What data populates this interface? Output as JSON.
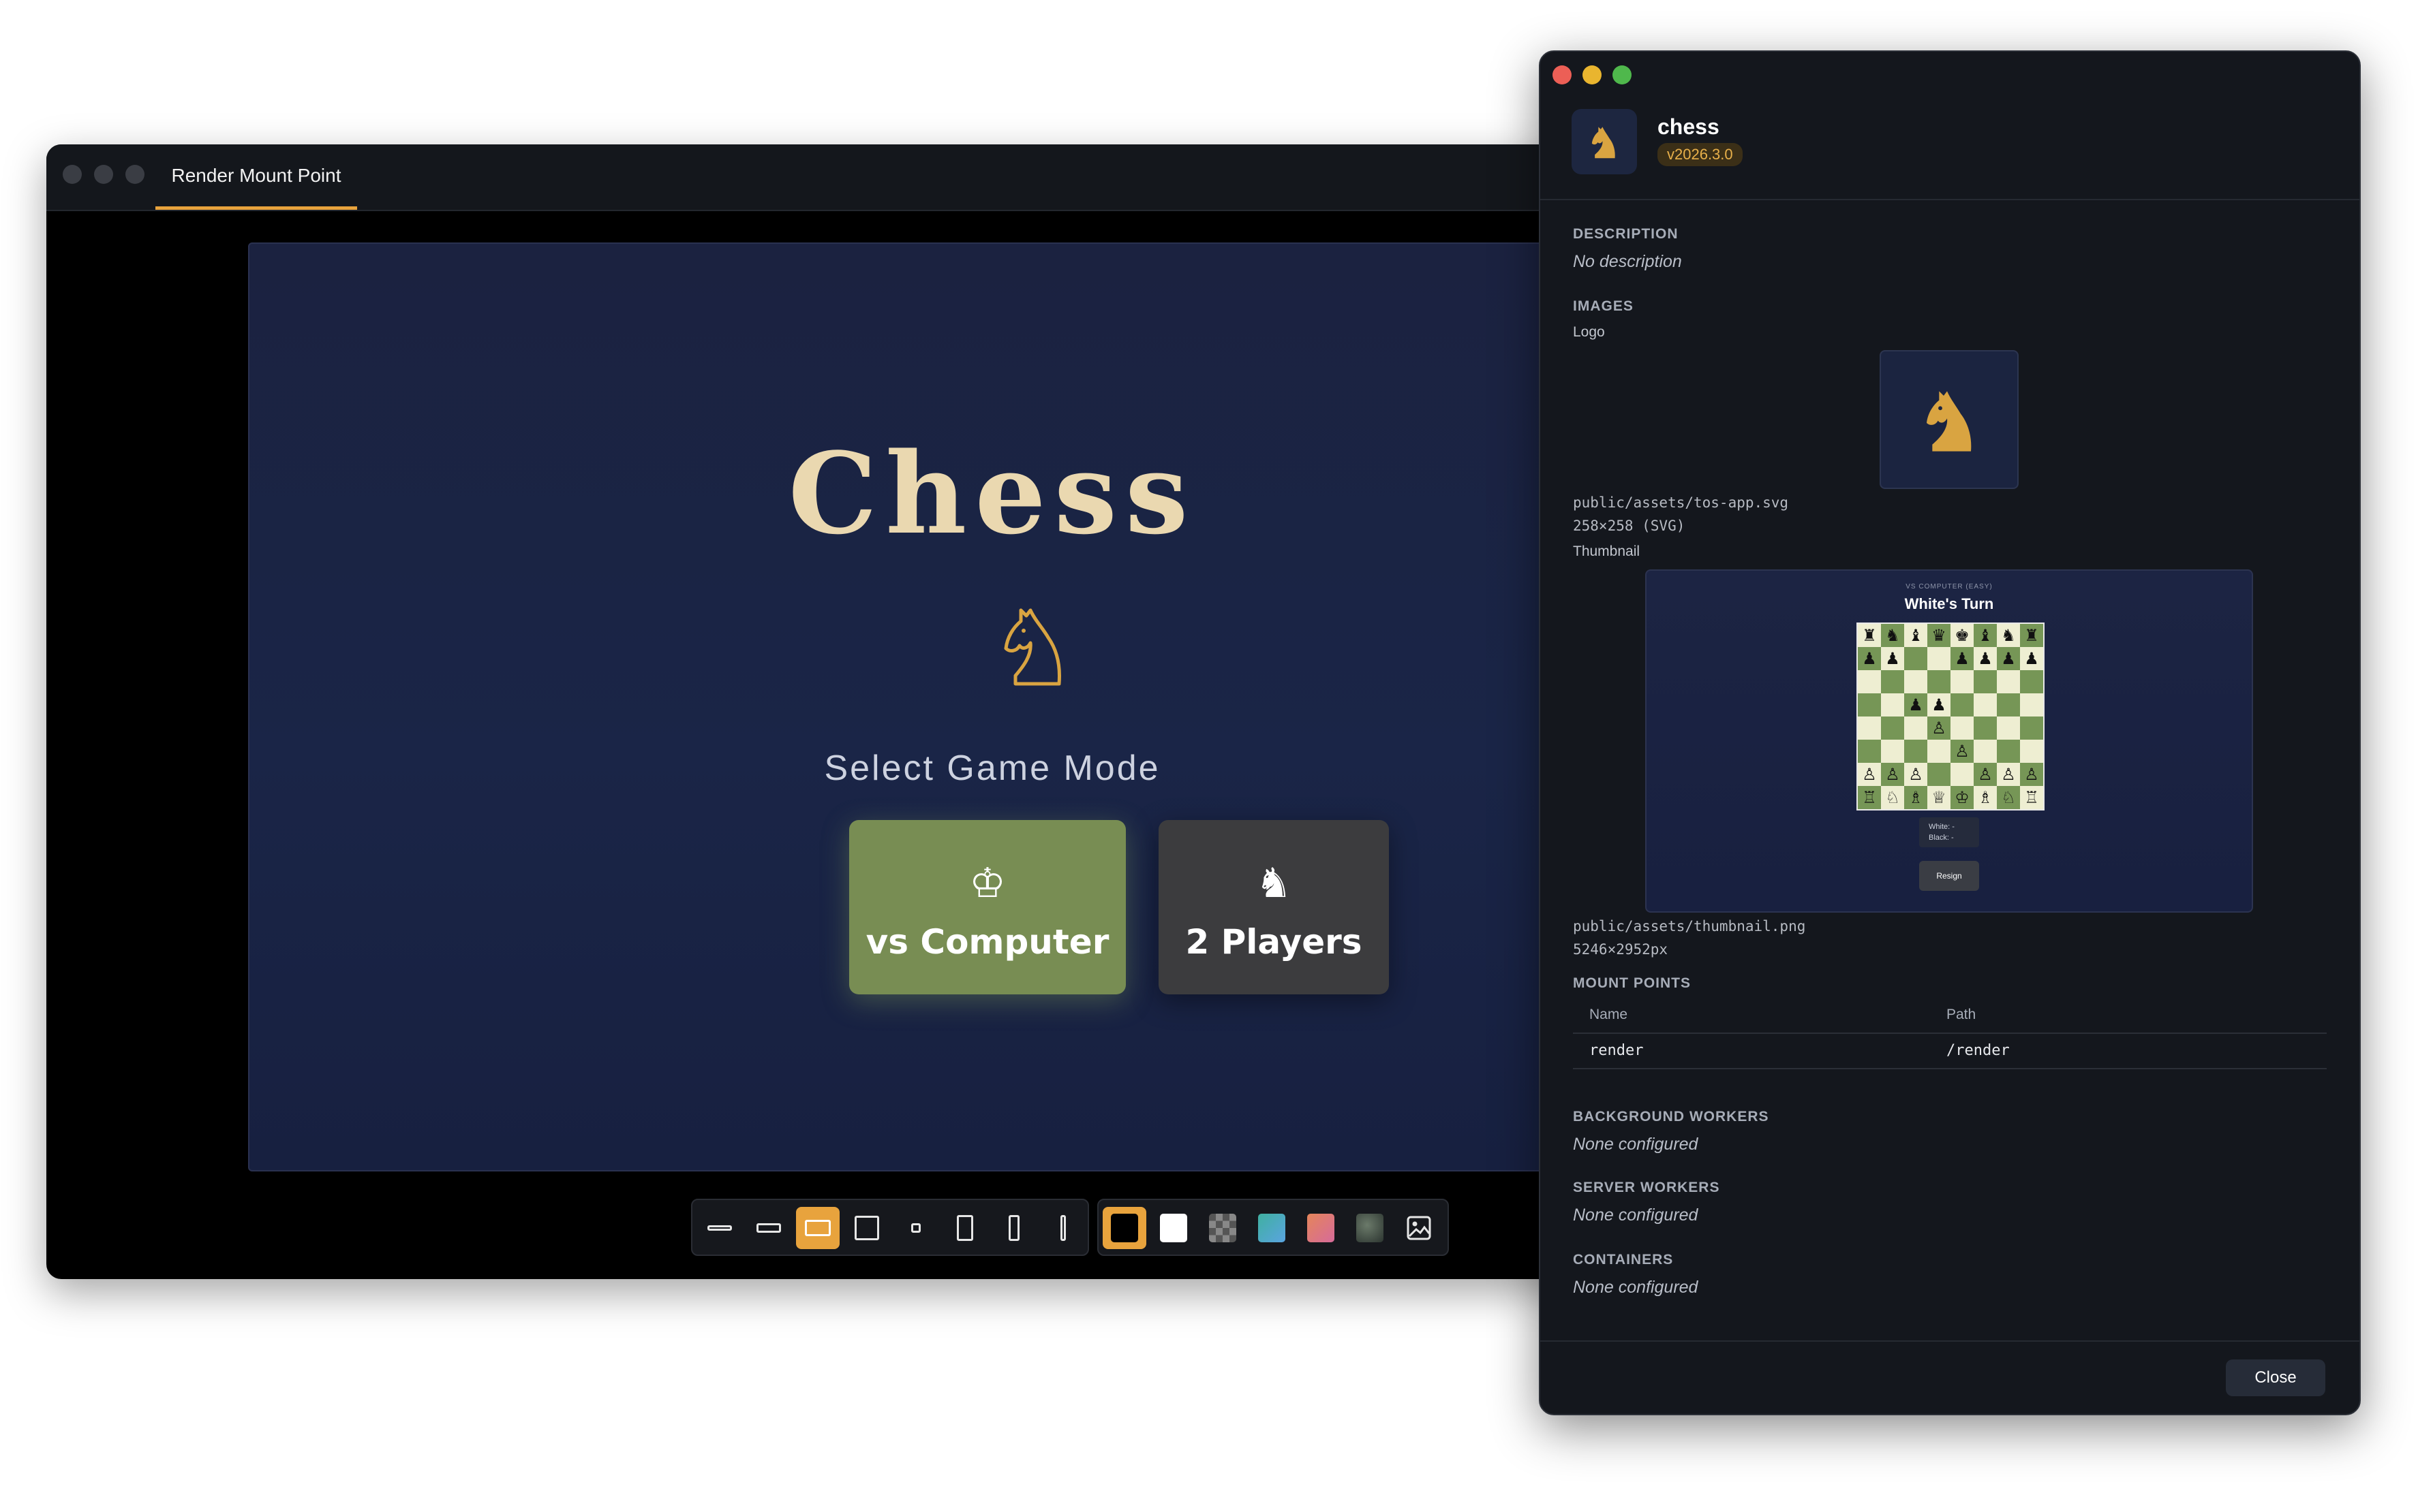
{
  "main_window": {
    "tab_label": "Render Mount Point",
    "game": {
      "title": "Chess",
      "select_label": "Select Game Mode",
      "vs_computer_label": "vs Computer",
      "vs_computer_icon": "♔",
      "two_players_label": "2 Players",
      "two_players_icon": "♞"
    },
    "toolbar": {
      "size_presets": [
        "wide-short",
        "wide",
        "landscape",
        "square",
        "tiny",
        "portrait",
        "tall",
        "very-tall"
      ],
      "active_size": 2,
      "backgrounds": [
        "black",
        "white",
        "checker",
        "teal-gradient",
        "sunset-gradient",
        "photo",
        "custom-image"
      ],
      "active_background": 0,
      "accent": "#e8a33d"
    }
  },
  "panel": {
    "app_name": "chess",
    "version": "v2026.3.0",
    "description_heading": "DESCRIPTION",
    "description": "No description",
    "images_heading": "IMAGES",
    "logo_label": "Logo",
    "logo_path": "public/assets/tos-app.svg",
    "logo_size": "258×258 (SVG)",
    "thumbnail_label": "Thumbnail",
    "thumbnail": {
      "subtitle": "VS COMPUTER (EASY)",
      "turn": "White's Turn",
      "white_label": "White: -",
      "black_label": "Black: -",
      "resign": "Resign"
    },
    "thumbnail_path": "public/assets/thumbnail.png",
    "thumbnail_size": "5246×2952px",
    "mount_points_heading": "MOUNT POINTS",
    "mount_points_columns": [
      "Name",
      "Path"
    ],
    "mount_points": [
      {
        "name": "render",
        "path": "/render"
      }
    ],
    "background_workers_heading": "BACKGROUND WORKERS",
    "background_workers": "None configured",
    "server_workers_heading": "SERVER WORKERS",
    "server_workers": "None configured",
    "containers_heading": "CONTAINERS",
    "containers": "None configured",
    "close_label": "Close"
  }
}
